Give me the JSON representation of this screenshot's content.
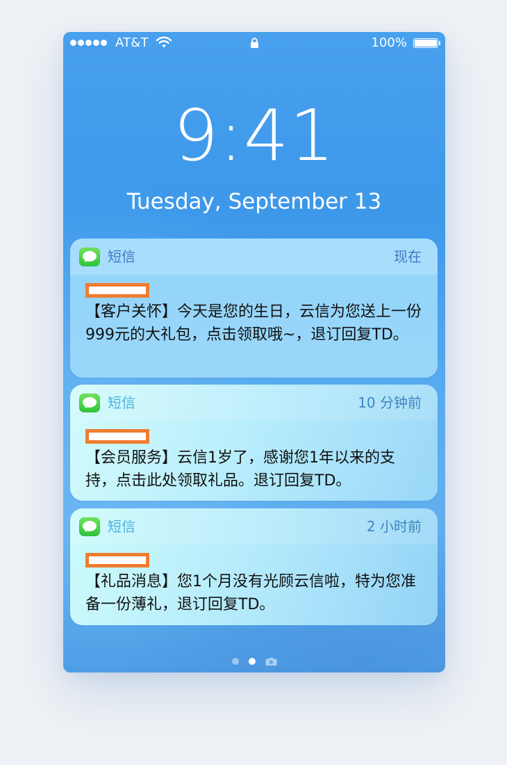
{
  "status": {
    "carrier": "AT&T",
    "battery_percent": "100%",
    "battery_level": 1.0,
    "signal_bars": 5
  },
  "lockscreen": {
    "time": "9:41",
    "date": "Tuesday, September 13"
  },
  "notifications": [
    {
      "app": "短信",
      "time": "现在",
      "message": "【客户关怀】今天是您的生日，云信为您送上一份999元的大礼包，点击领取哦~，退订回复TD。"
    },
    {
      "app": "短信",
      "time": "10 分钟前",
      "message": "【会员服务】云信1岁了，感谢您1年以来的支持，点击此处领取礼品。退订回复TD。"
    },
    {
      "app": "短信",
      "time": "2 小时前",
      "message": "【礼品消息】您1个月没有光顾云信啦，特为您准备一份薄礼，退订回复TD。"
    }
  ],
  "icons": {
    "status": [
      "signal-dots-icon",
      "wifi-icon",
      "lock-icon",
      "battery-icon"
    ],
    "app": "messages-app-icon",
    "pager": [
      "page-dot-icon",
      "page-dot-icon",
      "camera-icon"
    ]
  },
  "colors": {
    "wallpaper": "#3d98ea",
    "redaction": "#f07c2f",
    "messages_green": "#2fc53b"
  },
  "pager": {
    "pages": 3,
    "active_index": 1
  }
}
